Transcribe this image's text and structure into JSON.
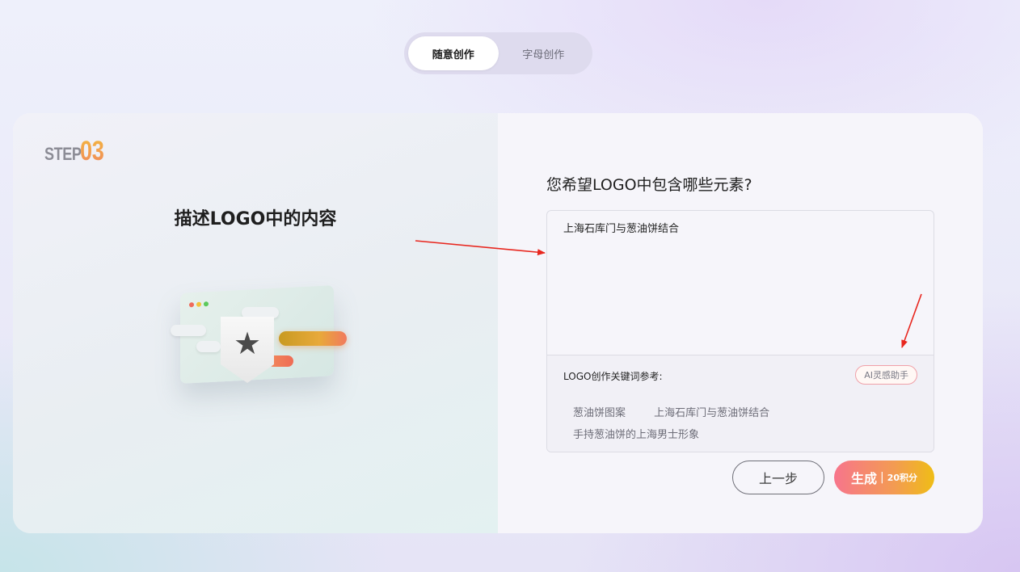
{
  "mode_tabs": [
    {
      "label": "随意创作",
      "active": true
    },
    {
      "label": "字母创作",
      "active": false
    }
  ],
  "step": {
    "word": "STEP",
    "number": "03"
  },
  "left_title": "描述LOGO中的内容",
  "question": "您希望LOGO中包含哪些元素?",
  "input_value": "上海石库门与葱油饼结合",
  "keywords_label": "LOGO创作关键词参考:",
  "ai_button": "AI灵感助手",
  "keywords": [
    "葱油饼图案",
    "上海石库门与葱油饼结合",
    "手持葱油饼的上海男士形象"
  ],
  "buttons": {
    "prev": "上一步",
    "generate": "生成",
    "separator": "|",
    "cost": "20积分"
  },
  "colors": {
    "accent_gradient_start": "#f7758c",
    "accent_gradient_end": "#efbd16",
    "annotation_arrow": "#e8261e"
  },
  "icons": [
    "star-icon",
    "window-dots-icon"
  ]
}
